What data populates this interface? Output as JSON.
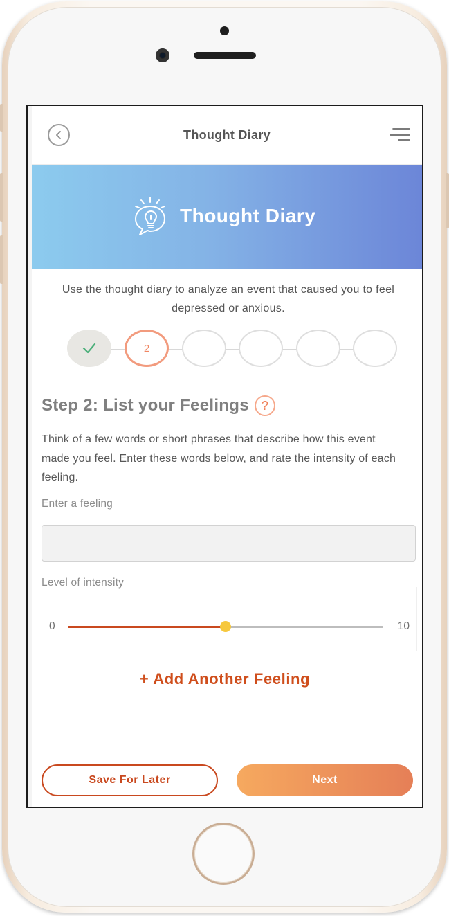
{
  "header": {
    "title": "Thought Diary",
    "back_icon": "chevron-left-icon",
    "menu_icon": "hamburger-menu-icon"
  },
  "hero": {
    "title": "Thought Diary",
    "icon": "lightbulb-speech-bubble-icon",
    "gradient_start": "#8ccbee",
    "gradient_end": "#6c86d8"
  },
  "intro": "Use the thought diary to analyze an event that caused you to feel depressed or anxious.",
  "progress": {
    "total_steps": 6,
    "current_step": 2,
    "steps": [
      {
        "label": "",
        "state": "done",
        "icon": "checkmark-icon"
      },
      {
        "label": "2",
        "state": "current"
      },
      {
        "label": "",
        "state": "upcoming"
      },
      {
        "label": "",
        "state": "upcoming"
      },
      {
        "label": "",
        "state": "upcoming"
      },
      {
        "label": "",
        "state": "upcoming"
      }
    ]
  },
  "step": {
    "title": "Step 2: List your Feelings",
    "help_label": "?",
    "description": "Think of a few words or short phrases that describe how this event made you feel. Enter these words below, and rate the intensity of each feeling."
  },
  "feeling_input": {
    "label": "Enter a feeling",
    "value": "",
    "placeholder": ""
  },
  "intensity": {
    "label": "Level of intensity",
    "min_label": "0",
    "max_label": "10",
    "min": 0,
    "max": 10,
    "value": 5
  },
  "add_feeling_label": "+ Add Another Feeling",
  "actions": {
    "save_label": "Save For Later",
    "next_label": "Next"
  },
  "colors": {
    "accent": "#c9491f",
    "slider_thumb": "#f6c83e",
    "step_current": "#f29b7e",
    "check": "#4caf7a"
  }
}
